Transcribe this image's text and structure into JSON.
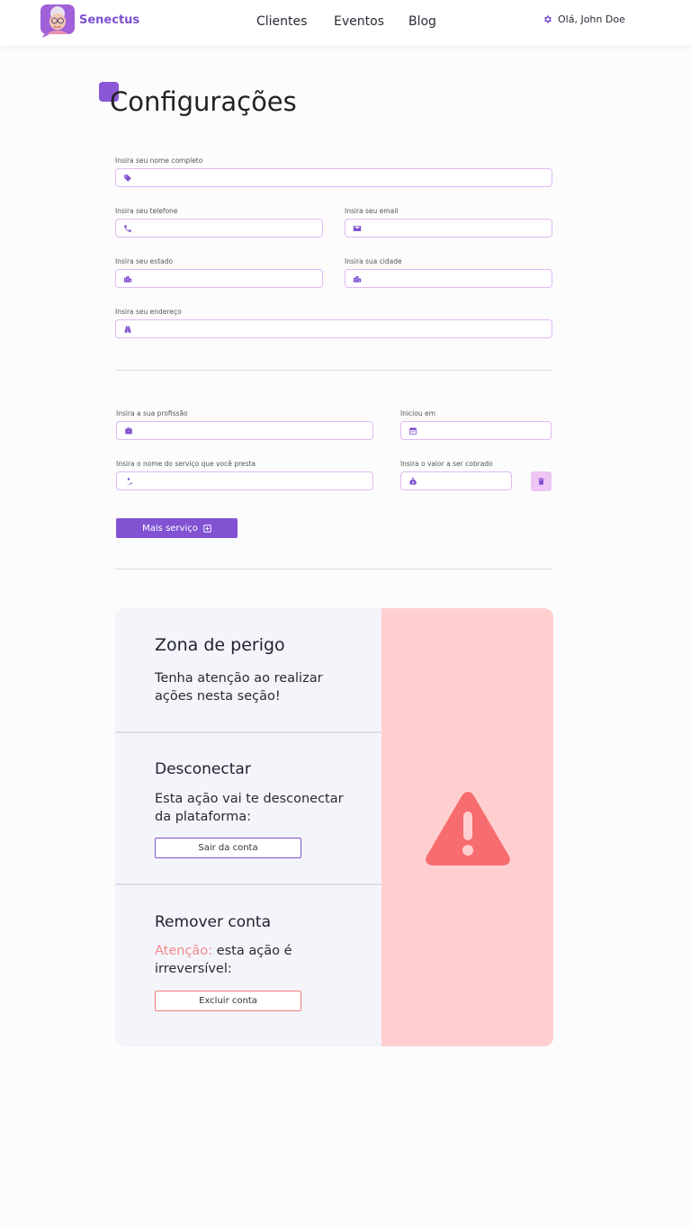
{
  "header": {
    "brand": "Senectus",
    "nav": [
      "Clientes",
      "Eventos",
      "Blog"
    ],
    "user_greeting": "Olá, John Doe"
  },
  "page": {
    "title": "Configurações"
  },
  "form": {
    "name_label": "Insira seu nome completo",
    "phone_label": "Insira seu telefone",
    "email_label": "Insira seu email",
    "state_label": "Insira seu estado",
    "city_label": "Insira sua cidade",
    "address_label": "Insira seu endereço",
    "profession_label": "Insira a sua profissão",
    "started_label": "Iniciou em",
    "service_label": "Insira o nome do serviço que você presta",
    "price_label": "Insira o valor a ser cobrado",
    "more_service_label": "Mais serviço"
  },
  "danger_zone": {
    "title": "Zona de perigo",
    "subtitle": "Tenha atenção ao realizar ações nesta seção!",
    "disconnect_title": "Desconectar",
    "disconnect_text": "Esta ação vai te desconectar da plataforma:",
    "logout_label": "Sair da conta",
    "remove_title": "Remover conta",
    "remove_warning": "Atenção:",
    "remove_text": " esta ação é irreversível:",
    "delete_label": "Excluir conta"
  },
  "colors": {
    "accent": "#8153d3",
    "field_border": "#e0b9f3",
    "danger_bg": "#ffcfd0",
    "danger_icon": "#f76c6e",
    "warning_text": "#f28a8a"
  }
}
